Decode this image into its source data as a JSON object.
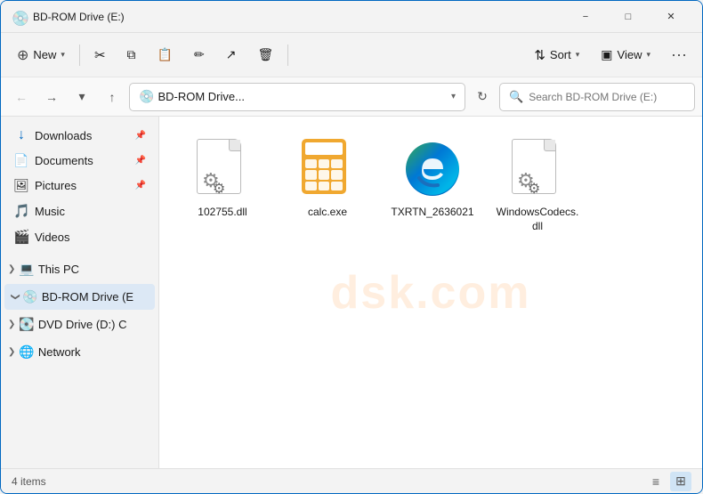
{
  "window": {
    "title": "BD-ROM Drive (E:)",
    "icon": "💿"
  },
  "toolbar": {
    "new_label": "New",
    "new_chevron": "▾",
    "cut_icon": "✂",
    "copy_icon": "⧉",
    "paste_icon": "📋",
    "rename_icon": "✏",
    "share_icon": "↗",
    "delete_icon": "🗑",
    "sort_label": "Sort",
    "sort_chevron": "▾",
    "sort_icon": "⇅",
    "view_label": "View",
    "view_chevron": "▾",
    "view_icon": "▣",
    "more_label": "···"
  },
  "address_bar": {
    "back_disabled": true,
    "forward_disabled": false,
    "recent_chevron": "▾",
    "up_icon": "↑",
    "drive_icon": "💿",
    "path_text": "BD-ROM Drive...",
    "path_chevron": "▾",
    "refresh_icon": "↻",
    "search_placeholder": "Search BD-ROM Drive (E:)"
  },
  "sidebar": {
    "items": [
      {
        "id": "downloads",
        "label": "Downloads",
        "icon": "↓",
        "icon_color": "#0067c0",
        "pinned": true
      },
      {
        "id": "documents",
        "label": "Documents",
        "icon": "📄",
        "pinned": true
      },
      {
        "id": "pictures",
        "label": "Pictures",
        "icon": "🖼",
        "pinned": true
      },
      {
        "id": "music",
        "label": "Music",
        "icon": "🎵",
        "pinned": false
      },
      {
        "id": "videos",
        "label": "Videos",
        "icon": "🎬",
        "pinned": false
      }
    ],
    "sections": [
      {
        "id": "this-pc",
        "label": "This PC",
        "icon": "💻",
        "expanded": false
      },
      {
        "id": "bdrom",
        "label": "BD-ROM Drive (E",
        "icon": "💿",
        "expanded": true,
        "active": true
      },
      {
        "id": "dvd",
        "label": "DVD Drive (D:) C",
        "icon": "💽",
        "expanded": false
      },
      {
        "id": "network",
        "label": "Network",
        "icon": "🌐",
        "expanded": false
      }
    ]
  },
  "files": [
    {
      "id": "file-1",
      "name": "102755.dll",
      "type": "dll",
      "icon_type": "gear-dll"
    },
    {
      "id": "file-2",
      "name": "calc.exe",
      "type": "exe",
      "icon_type": "calculator"
    },
    {
      "id": "file-3",
      "name": "TXRTN_2636021",
      "type": "exe",
      "icon_type": "edge"
    },
    {
      "id": "file-4",
      "name": "WindowsCodecs.\ndll",
      "name_display": "WindowsCodecs.dll",
      "type": "dll",
      "icon_type": "gear-dll"
    }
  ],
  "status_bar": {
    "items_count": "4 items",
    "view_list_icon": "≡",
    "view_grid_icon": "⊞"
  },
  "watermark": "dsk.com"
}
